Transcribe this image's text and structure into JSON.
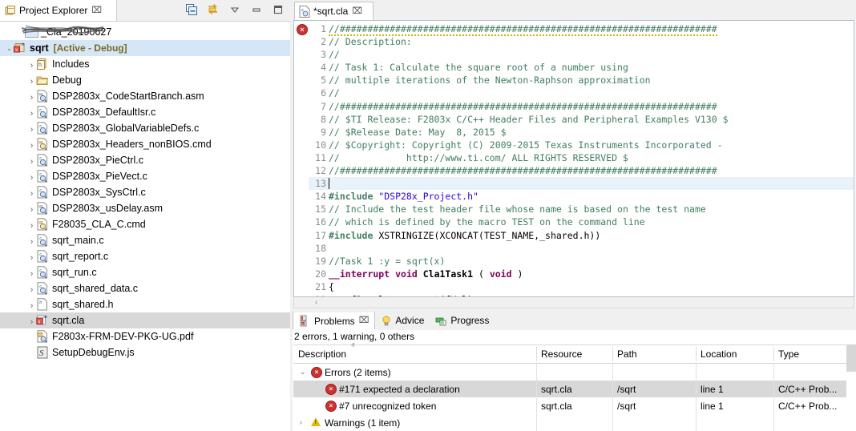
{
  "project_explorer": {
    "tab_label": "Project Explorer",
    "close_glyph": "⌧",
    "toolbar": [
      {
        "name": "collapse-all-icon",
        "title": "Collapse All"
      },
      {
        "name": "link-with-editor-icon",
        "title": "Link with Editor"
      },
      {
        "name": "view-menu-icon",
        "title": "View Menu"
      },
      {
        "name": "minimize-icon",
        "title": "Minimize"
      },
      {
        "name": "maximize-icon",
        "title": "Maximize"
      }
    ],
    "tree": [
      {
        "label": "_Cla_20190627",
        "icon": "folder-plain-icon",
        "indent": 1,
        "arrow": "",
        "redacted": true
      },
      {
        "label": "sqrt",
        "suffix": "[Active - Debug]",
        "icon": "project-icon",
        "indent": 0,
        "arrow": "⌄",
        "selected": true,
        "bold": true
      },
      {
        "label": "Includes",
        "icon": "includes-icon",
        "indent": 2,
        "arrow": "›"
      },
      {
        "label": "Debug",
        "icon": "folder-open-icon",
        "indent": 2,
        "arrow": "›"
      },
      {
        "label": "DSP2803x_CodeStartBranch.asm",
        "icon": "asm-file-icon",
        "indent": 2,
        "arrow": "›"
      },
      {
        "label": "DSP2803x_DefaultIsr.c",
        "icon": "c-file-icon",
        "indent": 2,
        "arrow": "›"
      },
      {
        "label": "DSP2803x_GlobalVariableDefs.c",
        "icon": "c-file-icon",
        "indent": 2,
        "arrow": "›"
      },
      {
        "label": "DSP2803x_Headers_nonBIOS.cmd",
        "icon": "cmd-file-icon",
        "indent": 2,
        "arrow": "›"
      },
      {
        "label": "DSP2803x_PieCtrl.c",
        "icon": "c-file-icon",
        "indent": 2,
        "arrow": "›"
      },
      {
        "label": "DSP2803x_PieVect.c",
        "icon": "c-file-icon",
        "indent": 2,
        "arrow": "›"
      },
      {
        "label": "DSP2803x_SysCtrl.c",
        "icon": "c-file-icon",
        "indent": 2,
        "arrow": "›"
      },
      {
        "label": "DSP2803x_usDelay.asm",
        "icon": "asm-file-icon",
        "indent": 2,
        "arrow": "›"
      },
      {
        "label": "F28035_CLA_C.cmd",
        "icon": "cmd-file-icon",
        "indent": 2,
        "arrow": "›"
      },
      {
        "label": "sqrt_main.c",
        "icon": "c-file-icon",
        "indent": 2,
        "arrow": "›"
      },
      {
        "label": "sqrt_report.c",
        "icon": "c-file-icon",
        "indent": 2,
        "arrow": "›"
      },
      {
        "label": "sqrt_run.c",
        "icon": "c-file-icon",
        "indent": 2,
        "arrow": "›"
      },
      {
        "label": "sqrt_shared_data.c",
        "icon": "c-file-icon",
        "indent": 2,
        "arrow": "›"
      },
      {
        "label": "sqrt_shared.h",
        "icon": "h-file-icon",
        "indent": 2,
        "arrow": "›"
      },
      {
        "label": "sqrt.cla",
        "icon": "cla-file-icon",
        "indent": 2,
        "arrow": "›",
        "gray_selected": true
      },
      {
        "label": "F2803x-FRM-DEV-PKG-UG.pdf",
        "icon": "pdf-file-icon",
        "indent": 2,
        "arrow": ""
      },
      {
        "label": "SetupDebugEnv.js",
        "icon": "js-file-icon",
        "indent": 2,
        "arrow": ""
      }
    ]
  },
  "editor": {
    "tab_label": "*sqrt.cla",
    "tab_icon": "c-file-icon",
    "close_glyph": "⌧",
    "gutter_error_glyph": "×",
    "scroll_left_glyph": "‹",
    "current_line": 13,
    "lines": [
      {
        "n": 1,
        "type": "hashrule",
        "text": "//####################################################################"
      },
      {
        "n": 2,
        "type": "comment",
        "text": "// Description:"
      },
      {
        "n": 3,
        "type": "comment",
        "text": "//"
      },
      {
        "n": 4,
        "type": "comment",
        "text": "// Task 1: Calculate the square root of a number using"
      },
      {
        "n": 5,
        "type": "comment",
        "text": "// multiple iterations of the Newton-Raphson approximation"
      },
      {
        "n": 6,
        "type": "comment",
        "text": "//"
      },
      {
        "n": 7,
        "type": "hashrule",
        "text": "//####################################################################"
      },
      {
        "n": 8,
        "type": "comment",
        "text": "// $TI Release: F2803x C/C++ Header Files and Peripheral Examples V130 $"
      },
      {
        "n": 9,
        "type": "comment",
        "text": "// $Release Date: May  8, 2015 $"
      },
      {
        "n": 10,
        "type": "comment",
        "text": "// $Copyright: Copyright (C) 2009-2015 Texas Instruments Incorporated -"
      },
      {
        "n": 11,
        "type": "comment",
        "text": "//            http://www.ti.com/ ALL RIGHTS RESERVED $"
      },
      {
        "n": 12,
        "type": "hashrule",
        "text": "//####################################################################"
      },
      {
        "n": 13,
        "type": "blank",
        "text": ""
      },
      {
        "n": 14,
        "type": "include",
        "directive": "#include",
        "arg": " \"DSP28x_Project.h\""
      },
      {
        "n": 15,
        "type": "comment",
        "text": "// Include the test header file whose name is based on the test name"
      },
      {
        "n": 16,
        "type": "comment",
        "text": "// which is defined by the macro TEST on the command line"
      },
      {
        "n": 17,
        "type": "include2",
        "directive": "#include",
        "arg": " XSTRINGIZE(XCONCAT(TEST_NAME,_shared.h))"
      },
      {
        "n": 18,
        "type": "blank",
        "text": ""
      },
      {
        "n": 19,
        "type": "comment",
        "text": "//Task 1 :y = sqrt(x)"
      },
      {
        "n": 20,
        "type": "funcdecl",
        "kw1": "__interrupt",
        "kw2": " void ",
        "fname": "Cla1Task1",
        "tail": " ( ",
        "kw3": "void",
        "tail2": " )"
      },
      {
        "n": 21,
        "type": "plain",
        "text": "{"
      },
      {
        "n": 22,
        "type": "plain",
        "text": "    fResult = __sqrt(fVal);"
      },
      {
        "n": 23,
        "type": "plain",
        "text": "}"
      }
    ]
  },
  "problems_view": {
    "tabs": [
      {
        "label": "Problems",
        "icon": "problems-icon",
        "active": true,
        "close_glyph": "⌧"
      },
      {
        "label": "Advice",
        "icon": "lightbulb-icon",
        "active": false
      },
      {
        "label": "Progress",
        "icon": "progress-icon",
        "active": false
      }
    ],
    "summary": "2 errors, 1 warning, 0 others",
    "columns": [
      "Description",
      "Resource",
      "Path",
      "Location",
      "Type"
    ],
    "sort_indicator": "ⱏ",
    "rows": [
      {
        "kind": "group",
        "twisty": "⌄",
        "marker": "error",
        "description": "Errors (2 items)",
        "resource": "",
        "path": "",
        "location": "",
        "type": ""
      },
      {
        "kind": "item",
        "marker": "error",
        "description": "#171 expected a declaration",
        "resource": "sqrt.cla",
        "path": "/sqrt",
        "location": "line 1",
        "type": "C/C++ Prob...",
        "selected": true
      },
      {
        "kind": "item",
        "marker": "error",
        "description": "#7 unrecognized token",
        "resource": "sqrt.cla",
        "path": "/sqrt",
        "location": "line 1",
        "type": "C/C++ Prob..."
      },
      {
        "kind": "group",
        "twisty": "›",
        "marker": "warning",
        "description": "Warnings (1 item)",
        "resource": "",
        "path": "",
        "location": "",
        "type": ""
      }
    ]
  },
  "colors": {
    "selection_blue": "#d6e6f7",
    "selection_gray": "#d8d8d8",
    "comment_green": "#3f7f5f",
    "keyword_purple": "#7f0055",
    "string_blue": "#2a00ff",
    "error_red": "#cf3030",
    "warning_yellow": "#e8b900",
    "current_line": "#e8f2fb",
    "chrome_gray": "#f0f0f0"
  }
}
